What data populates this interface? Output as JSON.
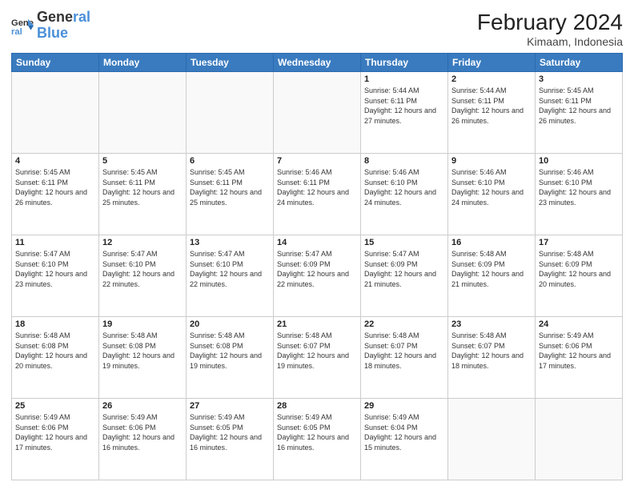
{
  "header": {
    "logo_line1": "General",
    "logo_line2": "Blue",
    "month_title": "February 2024",
    "subtitle": "Kimaam, Indonesia"
  },
  "days_of_week": [
    "Sunday",
    "Monday",
    "Tuesday",
    "Wednesday",
    "Thursday",
    "Friday",
    "Saturday"
  ],
  "weeks": [
    [
      {
        "day": "",
        "info": ""
      },
      {
        "day": "",
        "info": ""
      },
      {
        "day": "",
        "info": ""
      },
      {
        "day": "",
        "info": ""
      },
      {
        "day": "1",
        "info": "Sunrise: 5:44 AM\nSunset: 6:11 PM\nDaylight: 12 hours\nand 27 minutes."
      },
      {
        "day": "2",
        "info": "Sunrise: 5:44 AM\nSunset: 6:11 PM\nDaylight: 12 hours\nand 26 minutes."
      },
      {
        "day": "3",
        "info": "Sunrise: 5:45 AM\nSunset: 6:11 PM\nDaylight: 12 hours\nand 26 minutes."
      }
    ],
    [
      {
        "day": "4",
        "info": "Sunrise: 5:45 AM\nSunset: 6:11 PM\nDaylight: 12 hours\nand 26 minutes."
      },
      {
        "day": "5",
        "info": "Sunrise: 5:45 AM\nSunset: 6:11 PM\nDaylight: 12 hours\nand 25 minutes."
      },
      {
        "day": "6",
        "info": "Sunrise: 5:45 AM\nSunset: 6:11 PM\nDaylight: 12 hours\nand 25 minutes."
      },
      {
        "day": "7",
        "info": "Sunrise: 5:46 AM\nSunset: 6:11 PM\nDaylight: 12 hours\nand 24 minutes."
      },
      {
        "day": "8",
        "info": "Sunrise: 5:46 AM\nSunset: 6:10 PM\nDaylight: 12 hours\nand 24 minutes."
      },
      {
        "day": "9",
        "info": "Sunrise: 5:46 AM\nSunset: 6:10 PM\nDaylight: 12 hours\nand 24 minutes."
      },
      {
        "day": "10",
        "info": "Sunrise: 5:46 AM\nSunset: 6:10 PM\nDaylight: 12 hours\nand 23 minutes."
      }
    ],
    [
      {
        "day": "11",
        "info": "Sunrise: 5:47 AM\nSunset: 6:10 PM\nDaylight: 12 hours\nand 23 minutes."
      },
      {
        "day": "12",
        "info": "Sunrise: 5:47 AM\nSunset: 6:10 PM\nDaylight: 12 hours\nand 22 minutes."
      },
      {
        "day": "13",
        "info": "Sunrise: 5:47 AM\nSunset: 6:10 PM\nDaylight: 12 hours\nand 22 minutes."
      },
      {
        "day": "14",
        "info": "Sunrise: 5:47 AM\nSunset: 6:09 PM\nDaylight: 12 hours\nand 22 minutes."
      },
      {
        "day": "15",
        "info": "Sunrise: 5:47 AM\nSunset: 6:09 PM\nDaylight: 12 hours\nand 21 minutes."
      },
      {
        "day": "16",
        "info": "Sunrise: 5:48 AM\nSunset: 6:09 PM\nDaylight: 12 hours\nand 21 minutes."
      },
      {
        "day": "17",
        "info": "Sunrise: 5:48 AM\nSunset: 6:09 PM\nDaylight: 12 hours\nand 20 minutes."
      }
    ],
    [
      {
        "day": "18",
        "info": "Sunrise: 5:48 AM\nSunset: 6:08 PM\nDaylight: 12 hours\nand 20 minutes."
      },
      {
        "day": "19",
        "info": "Sunrise: 5:48 AM\nSunset: 6:08 PM\nDaylight: 12 hours\nand 19 minutes."
      },
      {
        "day": "20",
        "info": "Sunrise: 5:48 AM\nSunset: 6:08 PM\nDaylight: 12 hours\nand 19 minutes."
      },
      {
        "day": "21",
        "info": "Sunrise: 5:48 AM\nSunset: 6:07 PM\nDaylight: 12 hours\nand 19 minutes."
      },
      {
        "day": "22",
        "info": "Sunrise: 5:48 AM\nSunset: 6:07 PM\nDaylight: 12 hours\nand 18 minutes."
      },
      {
        "day": "23",
        "info": "Sunrise: 5:48 AM\nSunset: 6:07 PM\nDaylight: 12 hours\nand 18 minutes."
      },
      {
        "day": "24",
        "info": "Sunrise: 5:49 AM\nSunset: 6:06 PM\nDaylight: 12 hours\nand 17 minutes."
      }
    ],
    [
      {
        "day": "25",
        "info": "Sunrise: 5:49 AM\nSunset: 6:06 PM\nDaylight: 12 hours\nand 17 minutes."
      },
      {
        "day": "26",
        "info": "Sunrise: 5:49 AM\nSunset: 6:06 PM\nDaylight: 12 hours\nand 16 minutes."
      },
      {
        "day": "27",
        "info": "Sunrise: 5:49 AM\nSunset: 6:05 PM\nDaylight: 12 hours\nand 16 minutes."
      },
      {
        "day": "28",
        "info": "Sunrise: 5:49 AM\nSunset: 6:05 PM\nDaylight: 12 hours\nand 16 minutes."
      },
      {
        "day": "29",
        "info": "Sunrise: 5:49 AM\nSunset: 6:04 PM\nDaylight: 12 hours\nand 15 minutes."
      },
      {
        "day": "",
        "info": ""
      },
      {
        "day": "",
        "info": ""
      }
    ]
  ]
}
